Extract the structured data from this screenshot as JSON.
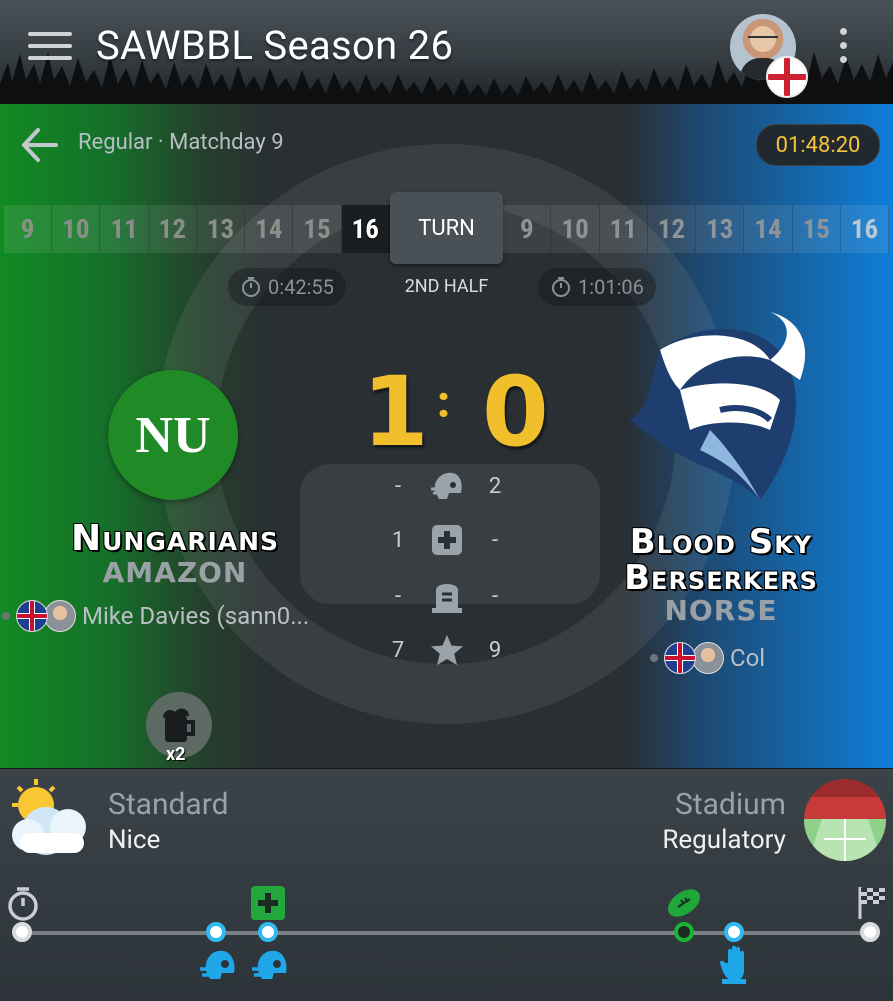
{
  "app": {
    "title": "SAWBBL Season 26"
  },
  "match": {
    "breadcrumb": "Regular · Matchday 9",
    "countdown": "01:48:20",
    "turn_label": "TURN",
    "half_label": "2ND HALF",
    "home_turns": [
      "9",
      "10",
      "11",
      "12",
      "13",
      "14",
      "15",
      "16"
    ],
    "home_current_turn": "16",
    "away_turns": [
      "9",
      "10",
      "11",
      "12",
      "13",
      "14",
      "15",
      "16"
    ],
    "home_clock": "0:42:55",
    "away_clock": "1:01:06",
    "score": {
      "home": "1",
      "separator": ":",
      "away": "0"
    },
    "stats": [
      {
        "icon": "casualty-helmet-icon",
        "home": "-",
        "away": "2"
      },
      {
        "icon": "apothecary-cross-icon",
        "home": "1",
        "away": "-"
      },
      {
        "icon": "tombstone-icon",
        "home": "-",
        "away": "-"
      },
      {
        "icon": "star-icon",
        "home": "7",
        "away": "9"
      }
    ],
    "home": {
      "logo_text": "NU",
      "name": "Nungarians",
      "race": "AMAZON",
      "coach": "Mike Davies (sann0...",
      "inducement_count": "x2"
    },
    "away": {
      "name_line1": "Blood Sky",
      "name_line2": "Berserkers",
      "race": "NORSE",
      "coach": "Col"
    }
  },
  "conditions": {
    "weather_label": "Standard",
    "weather_value": "Nice",
    "stadium_label": "Stadium",
    "stadium_value": "Regulatory"
  },
  "colors": {
    "accent_gold": "#f2bf2c",
    "home_green": "#128a22",
    "away_blue": "#0e7fd8"
  }
}
